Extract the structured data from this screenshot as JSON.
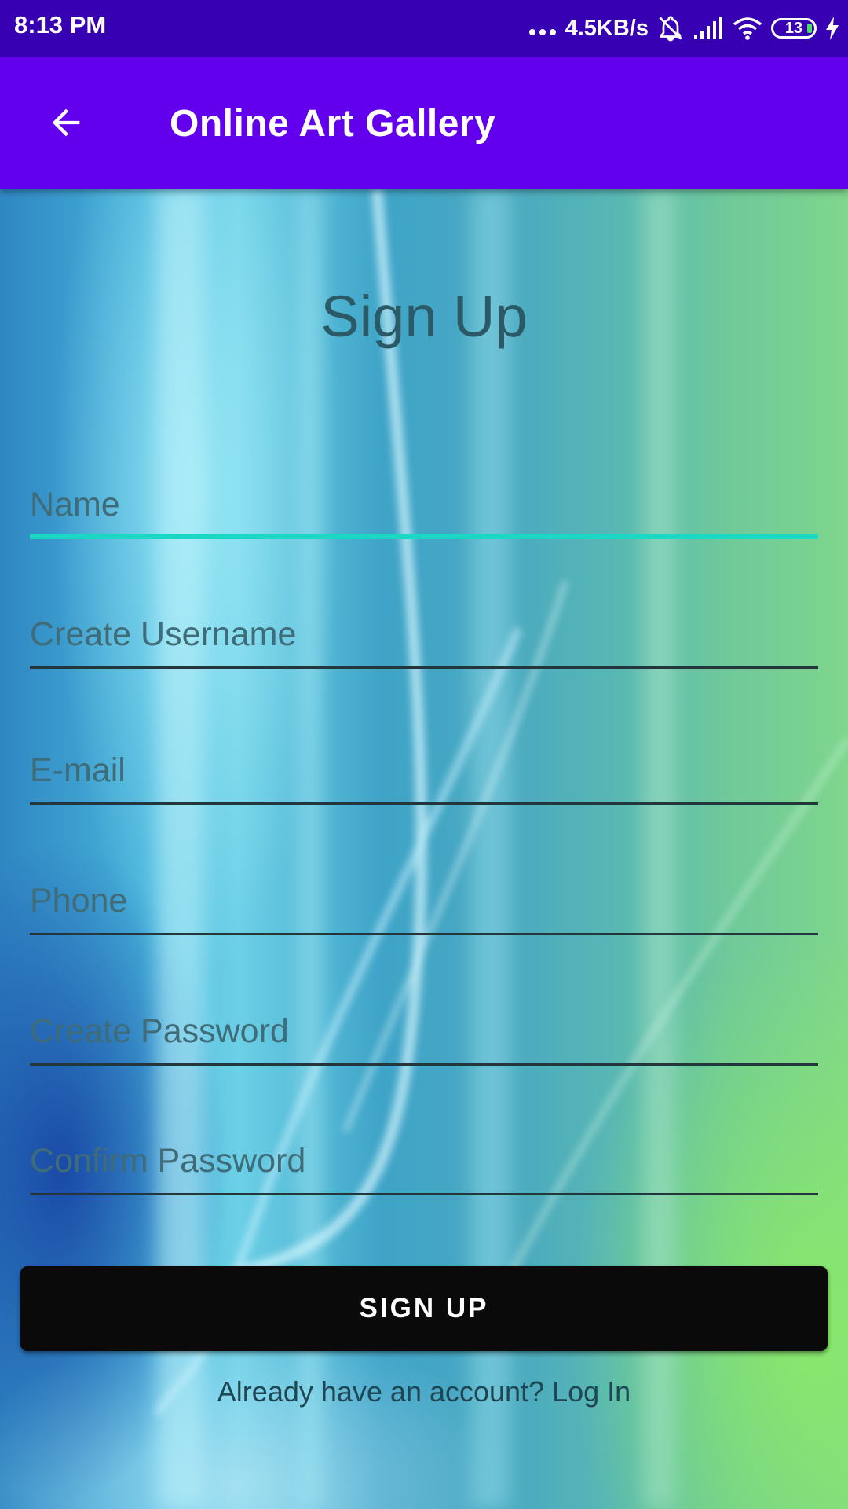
{
  "status_bar": {
    "time": "8:13 PM",
    "network_speed": "4.5KB/s",
    "battery_level": "13",
    "icons": [
      "more-dots-icon",
      "bell-muted-icon",
      "signal-icon",
      "wifi-icon",
      "battery-icon",
      "charging-bolt-icon"
    ]
  },
  "app_bar": {
    "title": "Online Art Gallery",
    "back_icon": "arrow-left-icon",
    "background_color": "#6200ee",
    "status_color": "#3700b3"
  },
  "form": {
    "title": "Sign Up",
    "fields": {
      "name": {
        "placeholder": "Name",
        "value": ""
      },
      "username": {
        "placeholder": "Create Username",
        "value": ""
      },
      "email": {
        "placeholder": "E-mail",
        "value": ""
      },
      "phone": {
        "placeholder": "Phone",
        "value": ""
      },
      "password": {
        "placeholder": "Create Password",
        "value": ""
      },
      "confirm_password": {
        "placeholder": "Confirm Password",
        "value": ""
      }
    },
    "active_field": "name",
    "focus_color": "#1ad8c4",
    "submit_label": "SIGN UP",
    "login_prompt": "Already have an account? Log In"
  }
}
